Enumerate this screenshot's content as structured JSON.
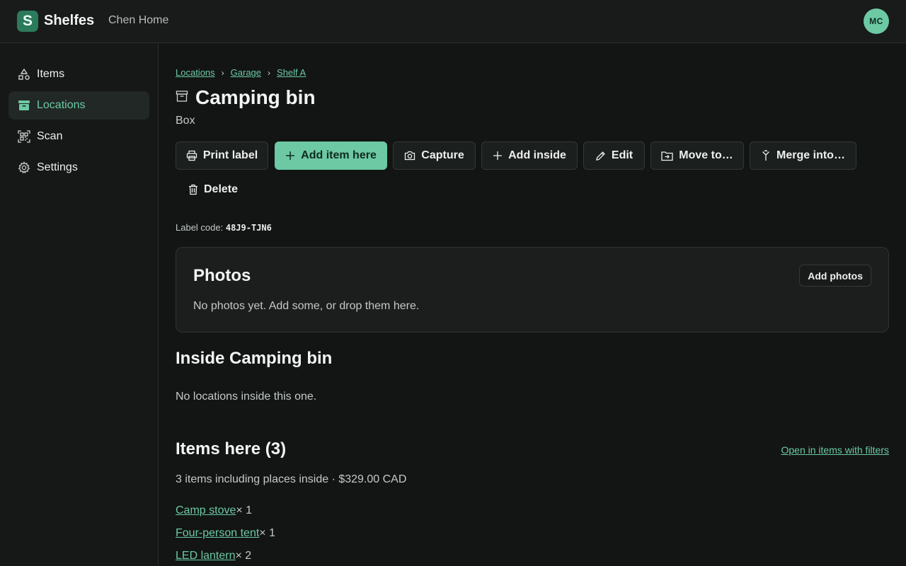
{
  "app": {
    "brand_letter": "S",
    "brand_name": "Shelfes",
    "household": "Chen Home",
    "avatar_initials": "MC",
    "accent_color": "#6cc9a4"
  },
  "sidebar": {
    "items": [
      {
        "label": "Items",
        "icon": "shapes-icon",
        "active": false
      },
      {
        "label": "Locations",
        "icon": "archive-box-icon",
        "active": true
      },
      {
        "label": "Scan",
        "icon": "qr-scan-icon",
        "active": false
      },
      {
        "label": "Settings",
        "icon": "gear-icon",
        "active": false
      }
    ]
  },
  "breadcrumb": [
    "Locations",
    "Garage",
    "Shelf A"
  ],
  "page": {
    "title": "Camping bin",
    "type": "Box"
  },
  "actions": {
    "print_label": "Print label",
    "add_item_here": "Add item here",
    "capture": "Capture",
    "add_inside": "Add inside",
    "edit": "Edit",
    "move_to": "Move to…",
    "merge_into": "Merge into…",
    "delete": "Delete"
  },
  "label_code": {
    "prefix": "Label code:",
    "value": "48J9-TJN6"
  },
  "photos": {
    "title": "Photos",
    "add_button": "Add photos",
    "empty_text": "No photos yet. Add some, or drop them here."
  },
  "inside": {
    "title": "Inside Camping bin",
    "empty_text": "No locations inside this one."
  },
  "items_here": {
    "title": "Items here (3)",
    "filter_link": "Open in items with filters",
    "summary": "3 items including places inside · $329.00 CAD",
    "list": [
      {
        "name": "Camp stove",
        "qty": "× 1"
      },
      {
        "name": "Four-person tent",
        "qty": "× 1"
      },
      {
        "name": "LED lantern",
        "qty": "× 2"
      }
    ]
  }
}
